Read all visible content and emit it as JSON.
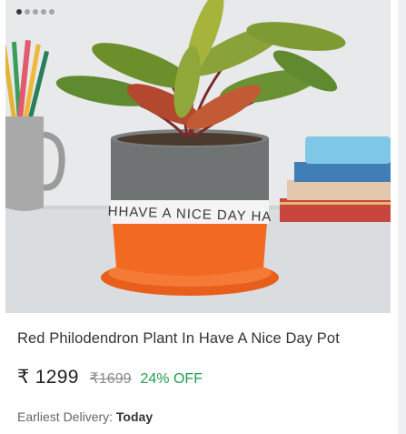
{
  "product": {
    "title": "Red Philodendron Plant In Have A Nice Day Pot",
    "price": "₹ 1299",
    "mrp": "₹1699",
    "discount": "24% OFF",
    "delivery_label": "Earliest Delivery:",
    "delivery_value": "Today",
    "pot_text": "HHAVE A NICE DAY HA"
  },
  "carousel": {
    "total_slides": 5,
    "active_slide": 1
  },
  "colors": {
    "price_text": "#222222",
    "mrp_text": "#8a8a8a",
    "discount_text": "#1e9e4c",
    "pot_top": "#6f7373",
    "pot_bottom": "#f26a22"
  }
}
